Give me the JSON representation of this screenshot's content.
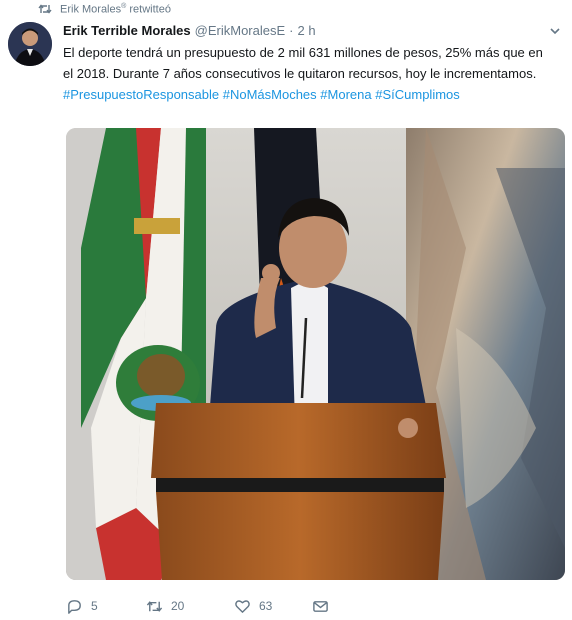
{
  "retweet_context": {
    "user": "Erik Morales",
    "badge": "®",
    "action": "retwitteó",
    "icon": "retweet-icon"
  },
  "tweet": {
    "author_name": "Erik Terrible Morales",
    "handle": "@ErikMoralesE",
    "separator": "·",
    "time": "2 h",
    "text_plain": "El deporte tendrá un presupuesto de 2 mil 631 millones de pesos, 25% más que en el 2018. Durante 7 años consecutivos le quitaron recursos, hoy le incrementamos.",
    "hashtags": [
      "#PresupuestoResponsable",
      "#NoMásMoches",
      "#Morena",
      "#SíCumplimos"
    ]
  },
  "actions": {
    "reply_count": "5",
    "retweet_count": "20",
    "like_count": "63"
  },
  "icons": [
    "retweet-icon",
    "chevron-down-icon",
    "reply-icon",
    "like-icon",
    "direct-message-icon"
  ],
  "colors": {
    "text": "#14171a",
    "secondary": "#657786",
    "link": "#1b95e0"
  }
}
